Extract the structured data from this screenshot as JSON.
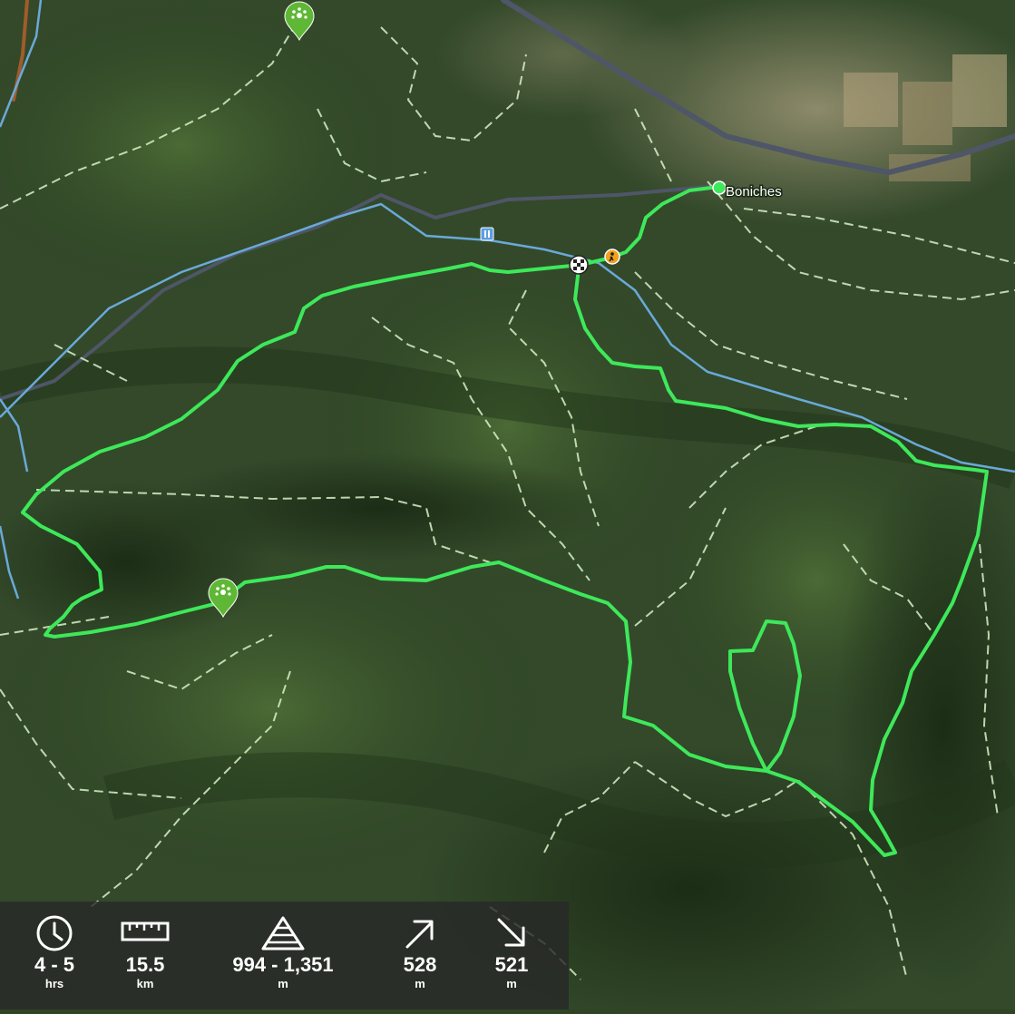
{
  "map": {
    "type": "satellite-hiking-map",
    "town_label": "Boniches",
    "route_color": "#3ee85a",
    "trail_color": "#d8f2c8",
    "river_color": "#6aa9d8",
    "road_color": "#4f5668",
    "start_marker_icon": "checkered-flag-icon",
    "poi_marker_icon": "viewpoint-marker-icon",
    "parking_icon": "parking-icon",
    "hiker_icon": "hiker-icon"
  },
  "stats": {
    "duration": {
      "icon": "clock-icon",
      "value": "4 - 5",
      "unit": "hrs"
    },
    "distance": {
      "icon": "ruler-icon",
      "value": "15.5",
      "unit": "km"
    },
    "elevation": {
      "icon": "mountain-icon",
      "value": "994 - 1,351",
      "unit": "m"
    },
    "ascent": {
      "icon": "arrow-up-right-icon",
      "value": "528",
      "unit": "m"
    },
    "descent": {
      "icon": "arrow-down-right-icon",
      "value": "521",
      "unit": "m"
    }
  }
}
